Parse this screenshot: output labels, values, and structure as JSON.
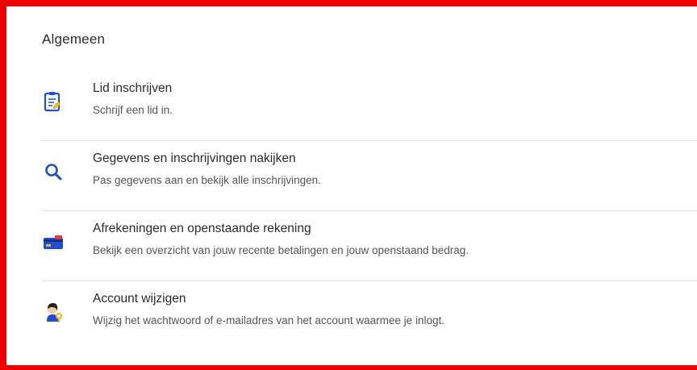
{
  "section": {
    "title": "Algemeen"
  },
  "items": [
    {
      "title": "Lid inschrijven",
      "description": "Schrijf een lid in.",
      "icon": "clipboard-pencil-icon"
    },
    {
      "title": "Gegevens en inschrijvingen nakijken",
      "description": "Pas gegevens aan en bekijk alle inschrijvingen.",
      "icon": "search-icon"
    },
    {
      "title": "Afrekeningen en openstaande rekening",
      "description": "Bekijk een overzicht van jouw recente betalingen en jouw openstaand bedrag.",
      "icon": "credit-card-icon"
    },
    {
      "title": "Account wijzigen",
      "description": "Wijzig het wachtwoord of e-mailadres van het account waarmee je inlogt.",
      "icon": "user-key-icon"
    }
  ],
  "colors": {
    "frame": "#ee0000",
    "accent_blue": "#1f4fd1",
    "accent_yellow": "#f2b418",
    "text": "#2b2b2b",
    "muted_text": "#555555"
  }
}
